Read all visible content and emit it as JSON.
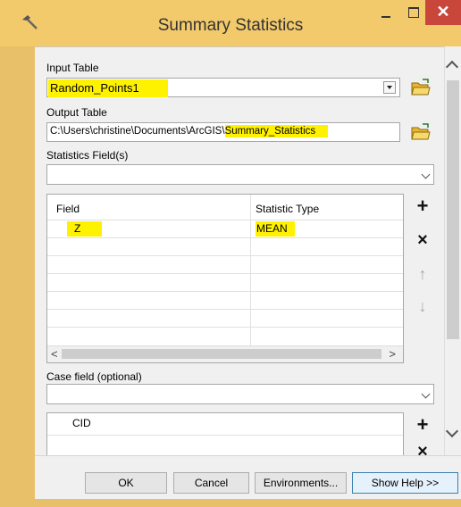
{
  "window": {
    "title": "Summary Statistics",
    "close_symbol": "✕"
  },
  "input_table": {
    "label": "Input Table",
    "value": "Random_Points1"
  },
  "output_table": {
    "label": "Output Table",
    "value_prefix": "C:\\Users\\christine\\Documents\\ArcGIS\\",
    "value_highlight": "Summary_Statistics"
  },
  "statistics_fields": {
    "label": "Statistics Field(s)",
    "value": "",
    "columns": [
      "Field",
      "Statistic Type"
    ],
    "rows": [
      {
        "field": "Z",
        "statistic_type": "MEAN"
      }
    ]
  },
  "case_field": {
    "label": "Case field (optional)",
    "value": "",
    "items": [
      "CID"
    ]
  },
  "icons": {
    "add": "+",
    "remove": "×",
    "move_up": "↑",
    "move_down": "↓",
    "scroll_left": "<",
    "scroll_right": ">"
  },
  "buttons": {
    "ok": "OK",
    "cancel": "Cancel",
    "environments": "Environments...",
    "show_help": "Show Help >>"
  },
  "colors": {
    "title_bar": "#f2c96b",
    "close_button": "#c9473a",
    "highlight": "#fff200"
  }
}
